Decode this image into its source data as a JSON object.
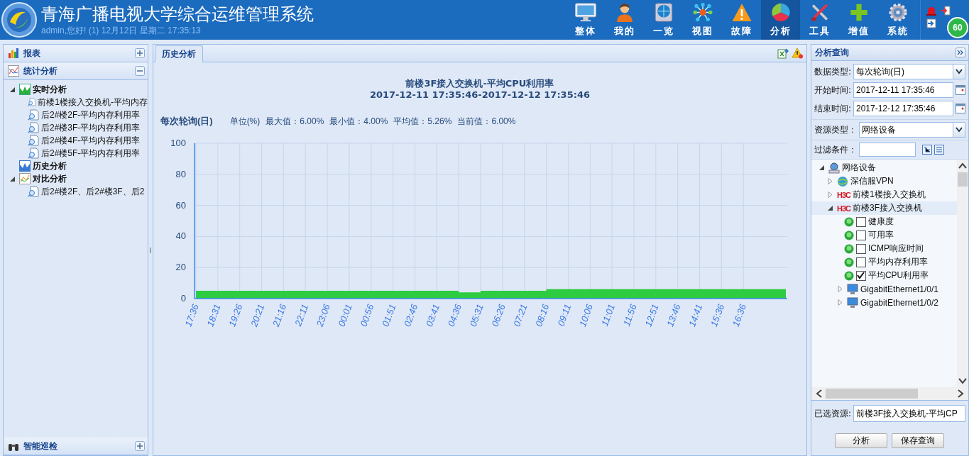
{
  "header": {
    "title": "青海广播电视大学综合运维管理系统",
    "subtitle": "admin,您好! (1) 12月12日 星期二 17:35:13",
    "badge": "60",
    "nav": [
      {
        "label": "整体",
        "selected": false
      },
      {
        "label": "我的",
        "selected": false
      },
      {
        "label": "一览",
        "selected": false
      },
      {
        "label": "视图",
        "selected": false
      },
      {
        "label": "故障",
        "selected": false
      },
      {
        "label": "分析",
        "selected": true
      },
      {
        "label": "工具",
        "selected": false
      },
      {
        "label": "增值",
        "selected": false
      },
      {
        "label": "系统",
        "selected": false
      }
    ]
  },
  "left_panel": {
    "sections": [
      {
        "title": "报表",
        "expanded": false
      },
      {
        "title": "统计分析",
        "expanded": true,
        "tree": [
          {
            "label": "实时分析",
            "kind": "realtime",
            "expanded": true,
            "children": [
              {
                "label": "前楼1楼接入交换机-平均内存"
              },
              {
                "label": "后2#楼2F-平均内存利用率"
              },
              {
                "label": "后2#楼3F-平均内存利用率"
              },
              {
                "label": "后2#楼4F-平均内存利用率"
              },
              {
                "label": "后2#楼5F-平均内存利用率"
              }
            ]
          },
          {
            "label": "历史分析",
            "kind": "history"
          },
          {
            "label": "对比分析",
            "kind": "compare",
            "expanded": true,
            "children": [
              {
                "label": "后2#楼2F、后2#楼3F、后2"
              }
            ]
          }
        ]
      }
    ],
    "bottom_section": {
      "title": "智能巡检",
      "expanded": false
    }
  },
  "center": {
    "tabs": [
      {
        "label": "历史分析",
        "selected": true
      }
    ],
    "chart_title": "前楼3F接入交换机-平均CPU利用率",
    "chart_subtitle": "2017-12-11 17:35:46-2017-12-12 17:35:46",
    "stats": [
      "单位(%)",
      "最大值：6.00%",
      "最小值：4.00%",
      "平均值：5.26%",
      "当前值：6.00%"
    ],
    "chart_data": {
      "type": "area",
      "grid": true,
      "categories": [
        "17:36",
        "18:31",
        "19:26",
        "20:21",
        "21:16",
        "22:11",
        "23:06",
        "00:01",
        "00:56",
        "01:51",
        "02:46",
        "03:41",
        "04:36",
        "05:31",
        "06:26",
        "07:21",
        "08:16",
        "09:11",
        "10:06",
        "11:01",
        "11:56",
        "12:51",
        "13:46",
        "14:41",
        "15:36",
        "16:36"
      ],
      "series": [
        {
          "name": "每次轮询(日)",
          "color": "#2ecc40",
          "values": [
            5,
            5,
            5,
            5,
            5,
            5,
            5,
            5,
            5,
            5,
            5,
            5,
            4,
            5,
            5,
            5,
            6,
            6,
            6,
            6,
            6,
            6,
            6,
            6,
            6,
            6
          ]
        }
      ],
      "ylim": [
        0,
        100
      ],
      "yticks": [
        0,
        20,
        40,
        60,
        80,
        100
      ]
    }
  },
  "right_panel": {
    "title": "分析查询",
    "fields": [
      {
        "label": "数据类型:",
        "value": "每次轮询(日)",
        "kind": "select"
      },
      {
        "label": "开始时间:",
        "value": "2017-12-11 17:35:46",
        "kind": "date"
      },
      {
        "label": "结束时间:",
        "value": "2017-12-12 17:35:46",
        "kind": "date"
      }
    ],
    "resource_type": {
      "label": "资源类型：",
      "value": "网络设备"
    },
    "filter": {
      "label": "过滤条件："
    },
    "tree": [
      {
        "label": "网络设备",
        "expanded": true,
        "children": [
          {
            "label": "深信服VPN",
            "kind": "vpn",
            "expanded": false
          },
          {
            "label": "前楼1楼接入交换机",
            "kind": "switch",
            "logo": "H3C",
            "expanded": false
          },
          {
            "label": "前楼3F接入交换机",
            "kind": "switch",
            "logo": "H3C",
            "expanded": true,
            "selected": true,
            "children": [
              {
                "label": "健康度",
                "kind": "metric",
                "checked": false
              },
              {
                "label": "可用率",
                "kind": "metric",
                "checked": false
              },
              {
                "label": "ICMP响应时间",
                "kind": "metric",
                "checked": false
              },
              {
                "label": "平均内存利用率",
                "kind": "metric",
                "checked": false
              },
              {
                "label": "平均CPU利用率",
                "kind": "metric",
                "checked": true
              },
              {
                "label": "GigabitEthernet1/0/1",
                "kind": "port",
                "expanded": false
              },
              {
                "label": "GigabitEthernet1/0/2",
                "kind": "port",
                "expanded": false
              }
            ]
          }
        ]
      }
    ],
    "selected_resource": {
      "label": "已选资源:",
      "value": "前楼3F接入交换机-平均CP"
    },
    "buttons": [
      "分析",
      "保存查询"
    ]
  }
}
